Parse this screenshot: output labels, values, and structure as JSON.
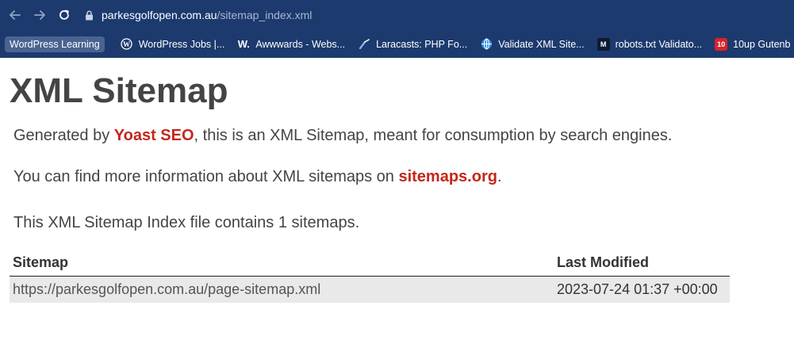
{
  "browser": {
    "url_host": "parkesgolfopen.com.au",
    "url_path": "/sitemap_index.xml",
    "bookmarks_folder": "WordPress Learning",
    "bookmarks": [
      {
        "label": "WordPress Jobs |...",
        "icon": "wordpress-icon"
      },
      {
        "label": "Awwwards - Webs...",
        "icon": "awwwards-icon",
        "glyph": "W."
      },
      {
        "label": "Laracasts: PHP Fo...",
        "icon": "laracasts-icon"
      },
      {
        "label": "Validate XML Site...",
        "icon": "globe-icon"
      },
      {
        "label": "robots.txt Validato...",
        "icon": "merkle-icon",
        "glyph": "M"
      },
      {
        "label": "10up Gutenb",
        "icon": "tenup-icon",
        "glyph": "10"
      }
    ]
  },
  "page": {
    "title": "XML Sitemap",
    "line1_prefix": "Generated by ",
    "line1_link": "Yoast SEO",
    "line1_suffix": ", this is an XML Sitemap, meant for consumption by search engines.",
    "line2_prefix": "You can find more information about XML sitemaps on ",
    "line2_link": "sitemaps.org",
    "line2_suffix": ".",
    "line3": "This XML Sitemap Index file contains 1 sitemaps."
  },
  "table": {
    "headers": [
      "Sitemap",
      "Last Modified"
    ],
    "rows": [
      {
        "sitemap": "https://parkesgolfopen.com.au/page-sitemap.xml",
        "modified": "2023-07-24 01:37 +00:00"
      }
    ]
  },
  "colors": {
    "chrome_bg": "#1c3a6e",
    "link": "#c3271c",
    "text": "#444444"
  }
}
